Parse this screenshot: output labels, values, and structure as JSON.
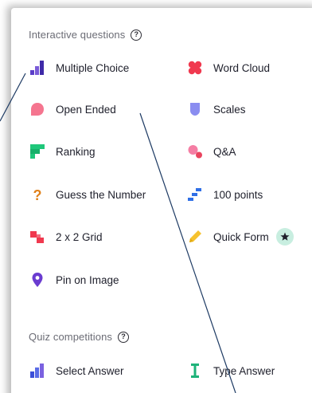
{
  "sections": {
    "interactive": {
      "title": "Interactive questions",
      "items": {
        "multiple_choice": "Multiple Choice",
        "word_cloud": "Word Cloud",
        "open_ended": "Open Ended",
        "scales": "Scales",
        "ranking": "Ranking",
        "qa": "Q&A",
        "guess_number": "Guess the Number",
        "points_100": "100 points",
        "grid_2x2": "2 x 2 Grid",
        "quick_form": "Quick Form",
        "pin_on_image": "Pin on Image"
      }
    },
    "quiz": {
      "title": "Quiz competitions",
      "items": {
        "select_answer": "Select Answer",
        "type_answer": "Type Answer"
      }
    }
  },
  "help_glyph": "?",
  "colors": {
    "multiple_choice": "#5b3ec8",
    "word_cloud": "#f0394f",
    "open_ended": "#f5758f",
    "scales": "#8a8df0",
    "ranking": "#1fc77a",
    "qa": "#f57ea4",
    "guess_number": "#e0811a",
    "points_100": "#2f6fe6",
    "grid_2x2": "#f0394f",
    "quick_form": "#f6c22e",
    "pin_on_image": "#6a3cd0",
    "select_answer": "#3b4fd8",
    "type_answer": "#1fb37a",
    "star_badge": "#c8eee0",
    "annotation_line": "#1d3a63"
  },
  "icons": {
    "multiple_choice": "bar-chart-icon",
    "word_cloud": "cloud-icon",
    "open_ended": "speech-bubble-icon",
    "scales": "shield-scale-icon",
    "ranking": "ranking-icon",
    "qa": "qa-bubbles-icon",
    "guess_number": "question-mark-icon",
    "points_100": "stairs-icon",
    "grid_2x2": "grid-icon",
    "quick_form": "pencil-icon",
    "quick_form_badge": "star-icon",
    "pin_on_image": "pin-icon",
    "select_answer": "bar-chart-icon",
    "type_answer": "text-cursor-icon"
  }
}
